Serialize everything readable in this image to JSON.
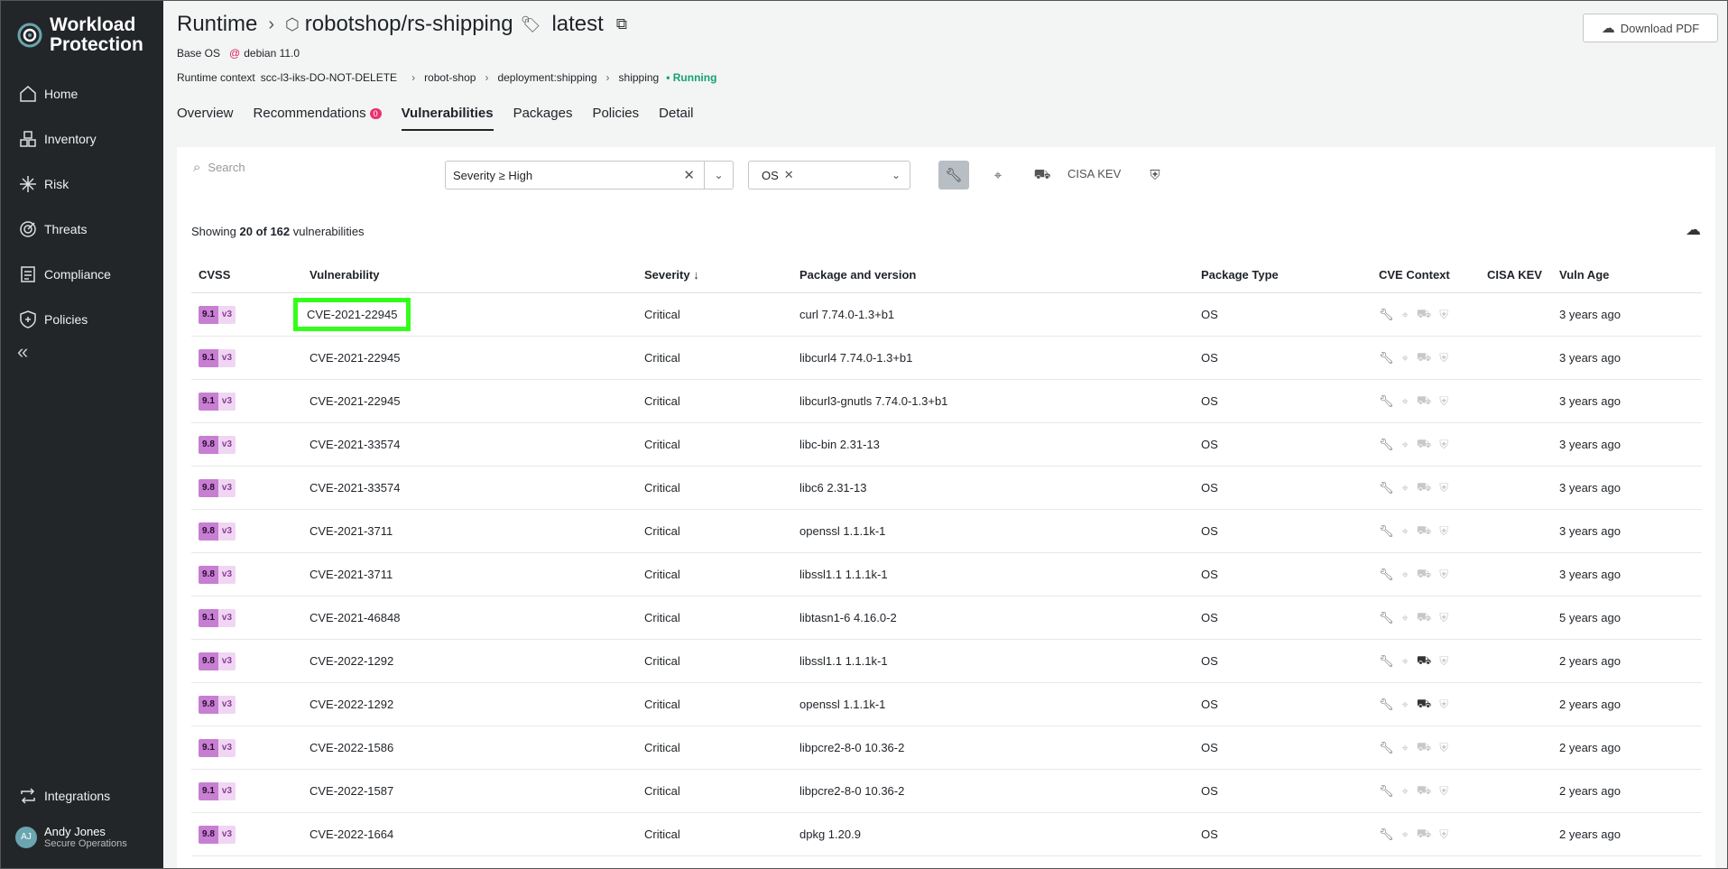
{
  "sidebar": {
    "logo": "Workload Protection",
    "items": [
      {
        "label": "Home",
        "icon": "home-icon"
      },
      {
        "label": "Inventory",
        "icon": "inventory-icon"
      },
      {
        "label": "Risk",
        "icon": "risk-icon"
      },
      {
        "label": "Threats",
        "icon": "threats-icon"
      },
      {
        "label": "Compliance",
        "icon": "compliance-icon"
      },
      {
        "label": "Policies",
        "icon": "policies-icon"
      }
    ],
    "integrations": "Integrations",
    "user": {
      "initials": "AJ",
      "name": "Andy Jones",
      "role": "Secure Operations"
    }
  },
  "header": {
    "root": "Runtime",
    "image": "robotshop/rs-shipping",
    "tag": "latest",
    "download_label": "Download PDF",
    "base_os_label": "Base OS",
    "base_os_value": "debian 11.0",
    "context_label": "Runtime context",
    "context": [
      "scc-l3-iks-DO-NOT-DELETE",
      "robot-shop",
      "deployment:shipping",
      "shipping"
    ],
    "status": "Running"
  },
  "tabs": [
    {
      "label": "Overview"
    },
    {
      "label": "Recommendations",
      "badge": "0"
    },
    {
      "label": "Vulnerabilities",
      "active": true
    },
    {
      "label": "Packages"
    },
    {
      "label": "Policies"
    },
    {
      "label": "Detail"
    }
  ],
  "filters": {
    "search_placeholder": "Search",
    "severity": "Severity ≥ High",
    "type": "OS",
    "cisa_kev": "CISA KEV"
  },
  "summary": {
    "prefix": "Showing",
    "shown": "20 of 162",
    "suffix": "vulnerabilities"
  },
  "table": {
    "columns": [
      "CVSS",
      "Vulnerability",
      "Severity",
      "Package and version",
      "Package Type",
      "CVE Context",
      "CISA KEV",
      "Vuln Age"
    ],
    "rows": [
      {
        "score": "9.1",
        "ver": "v3",
        "cve": "CVE-2021-22945",
        "severity": "Critical",
        "package": "curl 7.74.0-1.3+b1",
        "type": "OS",
        "age": "3 years ago",
        "highlight": true,
        "exploit": false
      },
      {
        "score": "9.1",
        "ver": "v3",
        "cve": "CVE-2021-22945",
        "severity": "Critical",
        "package": "libcurl4 7.74.0-1.3+b1",
        "type": "OS",
        "age": "3 years ago",
        "exploit": false
      },
      {
        "score": "9.1",
        "ver": "v3",
        "cve": "CVE-2021-22945",
        "severity": "Critical",
        "package": "libcurl3-gnutls 7.74.0-1.3+b1",
        "type": "OS",
        "age": "3 years ago",
        "exploit": false
      },
      {
        "score": "9.8",
        "ver": "v3",
        "cve": "CVE-2021-33574",
        "severity": "Critical",
        "package": "libc-bin 2.31-13",
        "type": "OS",
        "age": "3 years ago",
        "exploit": false
      },
      {
        "score": "9.8",
        "ver": "v3",
        "cve": "CVE-2021-33574",
        "severity": "Critical",
        "package": "libc6 2.31-13",
        "type": "OS",
        "age": "3 years ago",
        "exploit": false
      },
      {
        "score": "9.8",
        "ver": "v3",
        "cve": "CVE-2021-3711",
        "severity": "Critical",
        "package": "openssl 1.1.1k-1",
        "type": "OS",
        "age": "3 years ago",
        "exploit": false
      },
      {
        "score": "9.8",
        "ver": "v3",
        "cve": "CVE-2021-3711",
        "severity": "Critical",
        "package": "libssl1.1 1.1.1k-1",
        "type": "OS",
        "age": "3 years ago",
        "exploit": false
      },
      {
        "score": "9.1",
        "ver": "v3",
        "cve": "CVE-2021-46848",
        "severity": "Critical",
        "package": "libtasn1-6 4.16.0-2",
        "type": "OS",
        "age": "5 years ago",
        "exploit": false
      },
      {
        "score": "9.8",
        "ver": "v3",
        "cve": "CVE-2022-1292",
        "severity": "Critical",
        "package": "libssl1.1 1.1.1k-1",
        "type": "OS",
        "age": "2 years ago",
        "exploit": true
      },
      {
        "score": "9.8",
        "ver": "v3",
        "cve": "CVE-2022-1292",
        "severity": "Critical",
        "package": "openssl 1.1.1k-1",
        "type": "OS",
        "age": "2 years ago",
        "exploit": true
      },
      {
        "score": "9.1",
        "ver": "v3",
        "cve": "CVE-2022-1586",
        "severity": "Critical",
        "package": "libpcre2-8-0 10.36-2",
        "type": "OS",
        "age": "2 years ago",
        "exploit": false
      },
      {
        "score": "9.1",
        "ver": "v3",
        "cve": "CVE-2022-1587",
        "severity": "Critical",
        "package": "libpcre2-8-0 10.36-2",
        "type": "OS",
        "age": "2 years ago",
        "exploit": false
      },
      {
        "score": "9.8",
        "ver": "v3",
        "cve": "CVE-2022-1664",
        "severity": "Critical",
        "package": "dpkg 1.20.9",
        "type": "OS",
        "age": "2 years ago",
        "exploit": false
      }
    ]
  },
  "colors": {
    "accent_status": "#14a36e",
    "badge": "#e8336f",
    "highlight": "#33ff1a",
    "cvss": "#c77fd2"
  }
}
